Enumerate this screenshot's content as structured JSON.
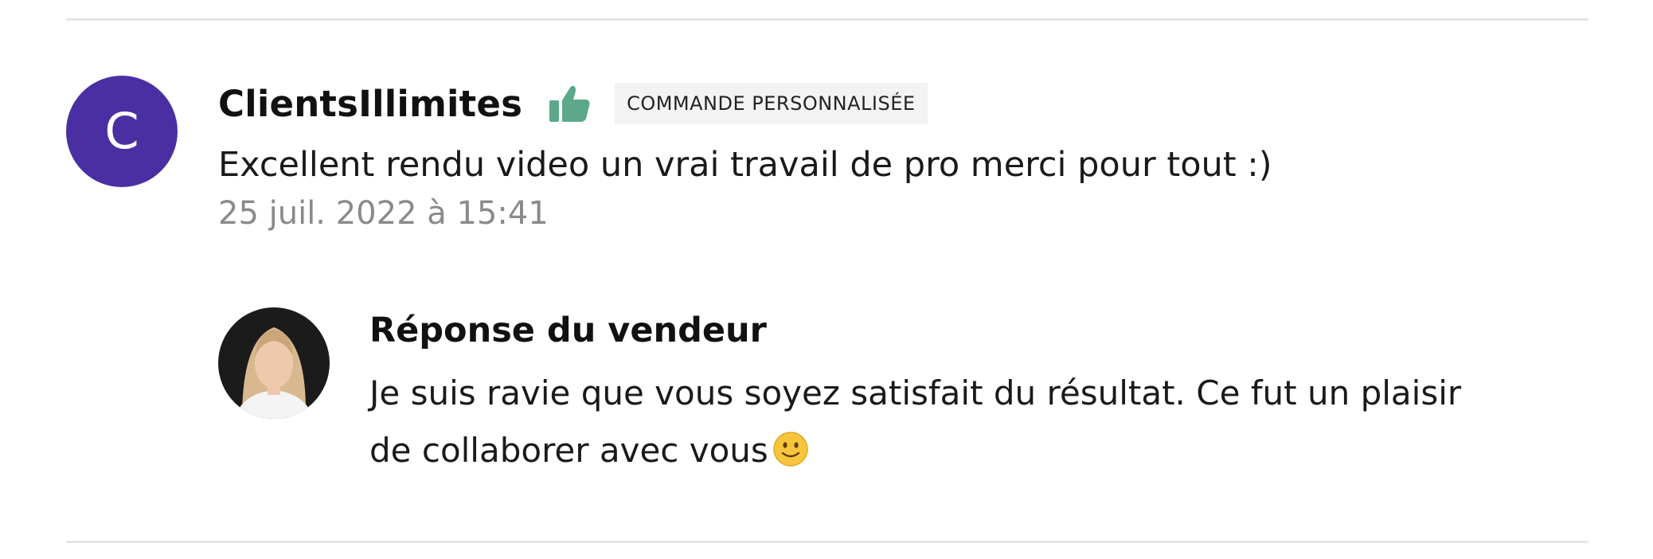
{
  "review": {
    "avatar_letter": "C",
    "avatar_color": "#4a2fa3",
    "username": "ClientsIllimites",
    "rating_icon": "thumbs-up-icon",
    "rating_color": "#5ba88a",
    "badge": "COMMANDE PERSONNALISÉE",
    "text": "Excellent rendu video un vrai travail de pro merci pour tout :)",
    "date": "25 juil. 2022 à 15:41"
  },
  "seller_reply": {
    "avatar": "seller-avatar-photo",
    "title": "Réponse du vendeur",
    "text_line1": "Je suis ravie que vous soyez satisfait du résultat. Ce fut un plaisir",
    "text_line2": "de collaborer avec vous",
    "emoji": "slightly-smiling-face-icon"
  }
}
